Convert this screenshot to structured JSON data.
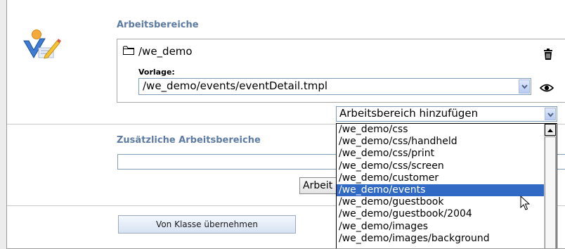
{
  "workspaces": {
    "title": "Arbeitsbereiche",
    "path": "/we_demo",
    "vorlage_label": "Vorlage:",
    "vorlage_value": "/we_demo/events/eventDetail.tmpl"
  },
  "add_workspace": {
    "selected_value": "Arbeitsbereich hinzufügen",
    "options": [
      "/we_demo/css",
      "/we_demo/css/handheld",
      "/we_demo/css/print",
      "/we_demo/css/screen",
      "/we_demo/customer",
      "/we_demo/events",
      "/we_demo/guestbook",
      "/we_demo/guestbook/2004",
      "/we_demo/images",
      "/we_demo/images/background"
    ],
    "highlighted_option": "/we_demo/events"
  },
  "additional": {
    "title": "Zusätzliche Arbeitsbereiche",
    "input_value": "",
    "button_label_partial": "Arbeit"
  },
  "class_button": {
    "label": "Von Klasse übernehmen"
  },
  "colors": {
    "section_title": "#5d7ba3",
    "selection": "#316ac5",
    "select_border": "#7f9db9"
  },
  "icons": [
    "workspace-logo-icon",
    "folder-icon",
    "trash-icon",
    "chevron-down-icon",
    "eye-icon",
    "scroll-up-arrow-icon",
    "mouse-cursor-icon"
  ]
}
